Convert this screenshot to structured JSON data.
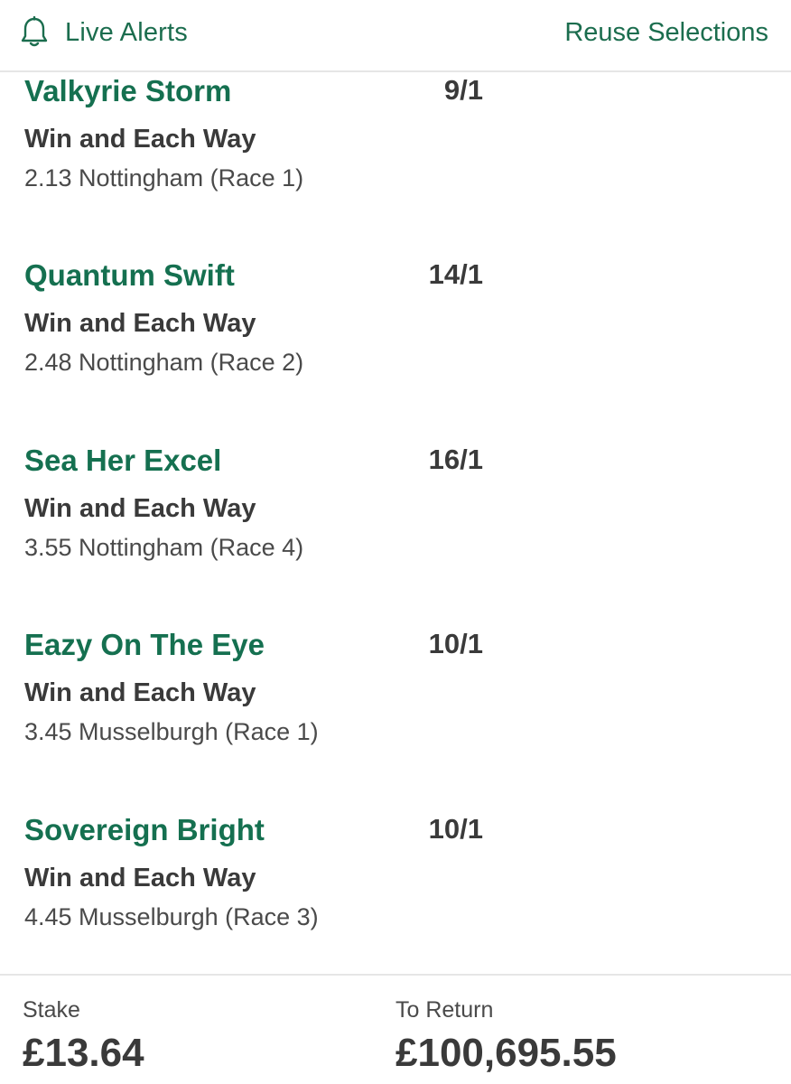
{
  "header": {
    "live_alerts_label": "Live Alerts",
    "live_alerts_icon": "bell-icon",
    "reuse_label": "Reuse Selections"
  },
  "colors": {
    "brand_green": "#157050",
    "text_dark": "#3a3a3a",
    "text_muted": "#4a4a4a",
    "divider": "#e6e6e6"
  },
  "selections": [
    {
      "name": "Valkyrie Storm",
      "odds": "9/1",
      "market": "Win and Each Way",
      "event": "2.13 Nottingham (Race 1)"
    },
    {
      "name": "Quantum Swift",
      "odds": "14/1",
      "market": "Win and Each Way",
      "event": "2.48 Nottingham (Race 2)"
    },
    {
      "name": "Sea Her Excel",
      "odds": "16/1",
      "market": "Win and Each Way",
      "event": "3.55 Nottingham (Race 4)"
    },
    {
      "name": "Eazy On The Eye",
      "odds": "10/1",
      "market": "Win and Each Way",
      "event": "3.45 Musselburgh (Race 1)"
    },
    {
      "name": "Sovereign Bright",
      "odds": "10/1",
      "market": "Win and Each Way",
      "event": "4.45 Musselburgh (Race 3)"
    }
  ],
  "footer": {
    "stake_label": "Stake",
    "stake_value": "£13.64",
    "return_label": "To Return",
    "return_value": "£100,695.55"
  }
}
